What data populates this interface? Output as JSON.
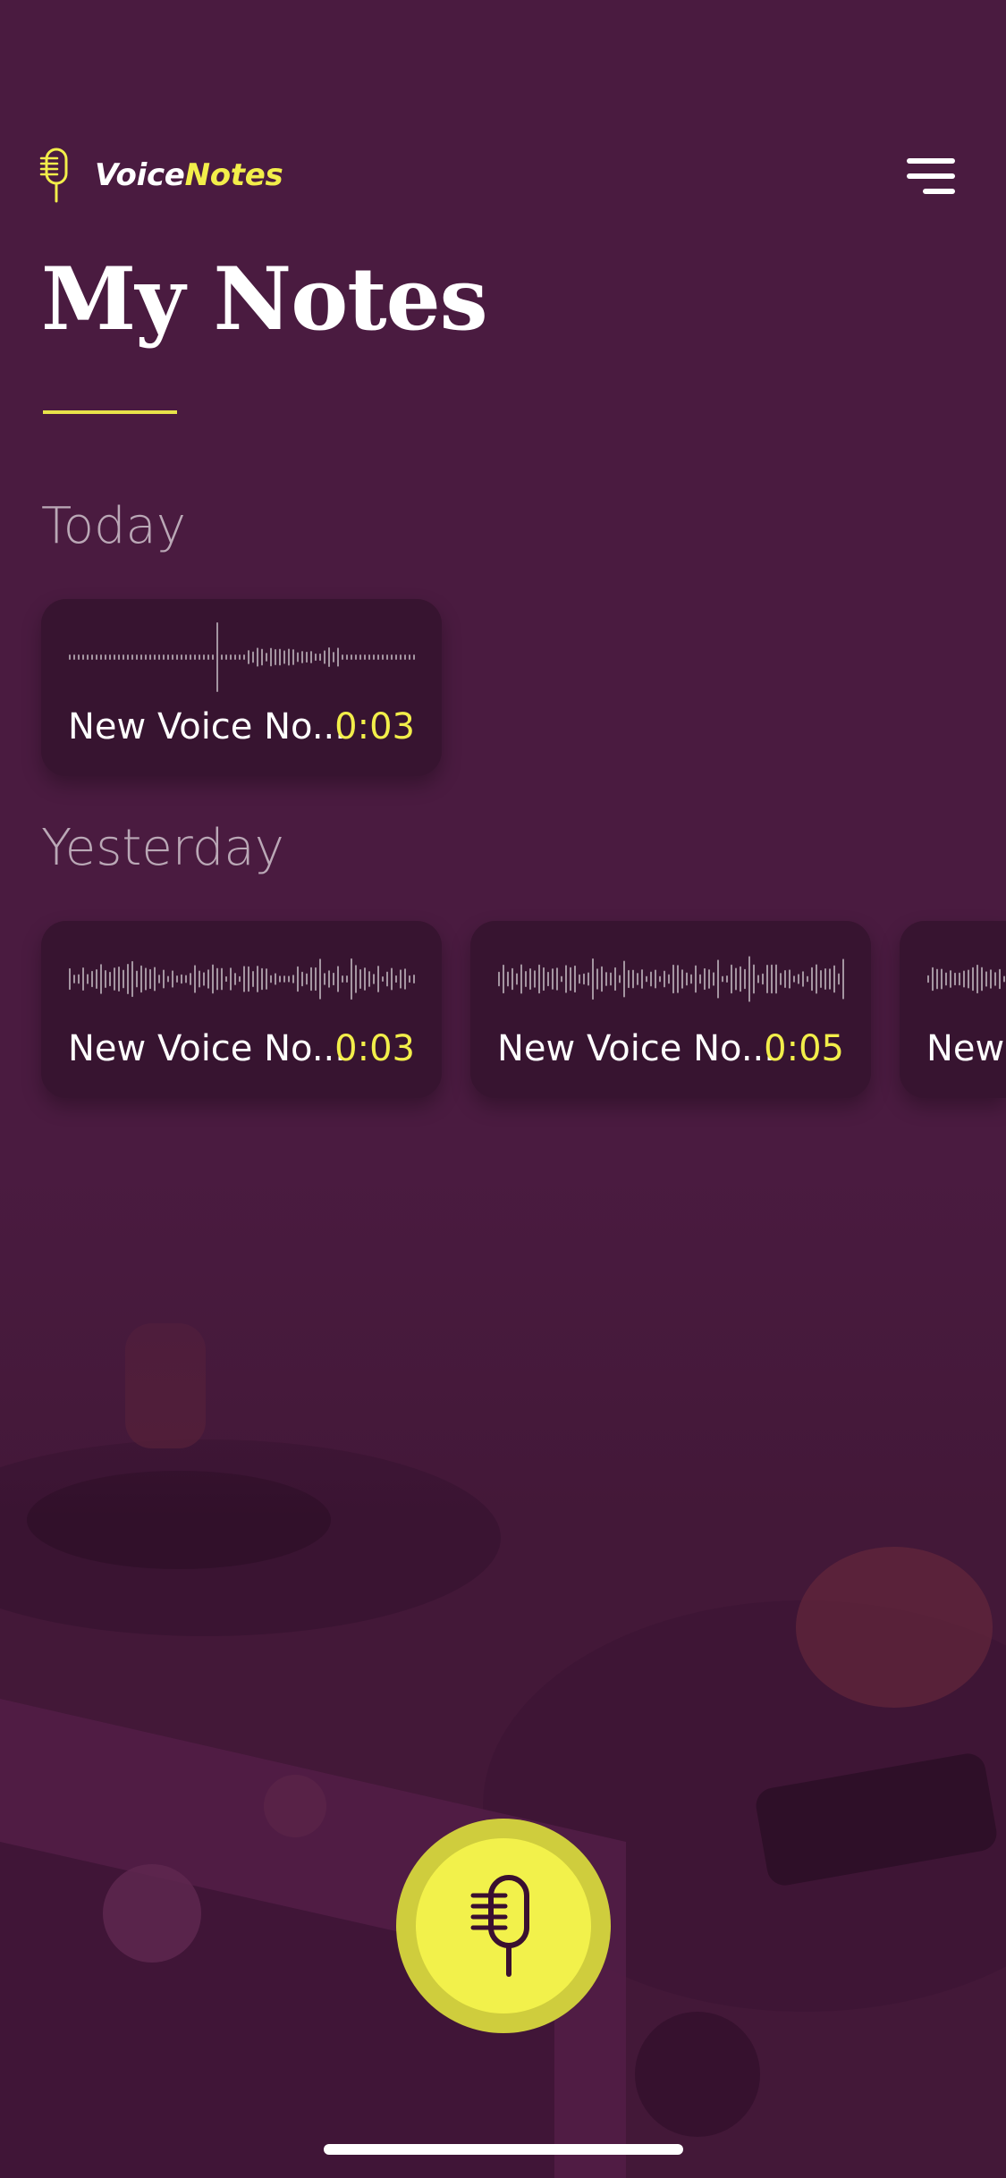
{
  "app": {
    "brand_part1": "Voice",
    "brand_part2": "Notes",
    "menu_icon": "hamburger-menu-icon",
    "logo_icon": "microphone-icon"
  },
  "page": {
    "title": "My Notes"
  },
  "sections": [
    {
      "label": "Today",
      "notes": [
        {
          "name": "New Voice No...",
          "duration": "0:03"
        }
      ]
    },
    {
      "label": "Yesterday",
      "notes": [
        {
          "name": "New Voice No...",
          "duration": "0:03"
        },
        {
          "name": "New Voice No...",
          "duration": "0:05"
        },
        {
          "name": "New"
        }
      ]
    }
  ],
  "record_button": {
    "icon": "microphone-icon"
  },
  "colors": {
    "background": "#4a1b40",
    "card": "#371430",
    "accent": "#f2ee4a",
    "fab_ring": "#cfcd3d",
    "fab": "#f2f14b"
  }
}
